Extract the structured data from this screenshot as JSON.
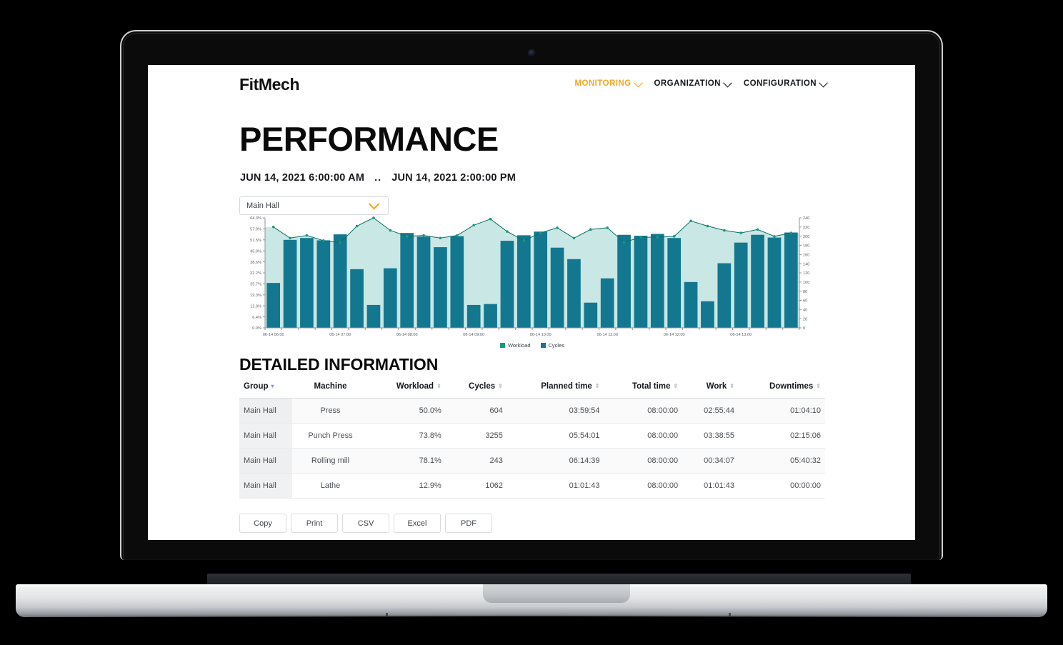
{
  "device": {
    "name": "laptop-mockup"
  },
  "nav": {
    "brand": "FitMech",
    "items": [
      {
        "label": "MONITORING",
        "active": true
      },
      {
        "label": "ORGANIZATION",
        "active": false
      },
      {
        "label": "CONFIGURATION",
        "active": false
      }
    ]
  },
  "page": {
    "title": "PERFORMANCE",
    "date_from": "JUN 14, 2021 6:00:00 AM",
    "date_sep": "..",
    "date_to": "JUN 14, 2021 2:00:00 PM",
    "group_select": {
      "value": "Main Hall"
    },
    "section_title": "DETAILED INFORMATION"
  },
  "colors": {
    "accent": "#F5A623",
    "cycles_bar": "#13788f",
    "cycles_bar_dark": "#136a84",
    "workload_line": "#17997f",
    "workload_area": "#c9e7e5",
    "text": "#14171a"
  },
  "chart_data": {
    "type": "bar",
    "title": "",
    "xlabel": "",
    "ylabel": "",
    "legend": [
      {
        "name": "Workload",
        "color": "#17997f"
      },
      {
        "name": "Cycles",
        "color": "#13788f"
      }
    ],
    "legend_position": "bottom-center",
    "grid": false,
    "y_left": {
      "label": "Workload",
      "ticks": [
        "0.0%",
        "6.4%",
        "12.9%",
        "19.3%",
        "25.7%",
        "32.2%",
        "38.6%",
        "45.0%",
        "51.5%",
        "57.9%",
        "64.3%"
      ],
      "min": 0.0,
      "max": 64.3
    },
    "y_right": {
      "label": "Cycles",
      "ticks": [
        0,
        20,
        40,
        60,
        80,
        100,
        120,
        140,
        160,
        180,
        200,
        220,
        240
      ],
      "min": 0,
      "max": 240
    },
    "x_ticks": [
      "06-14 06:00",
      "06-14 07:00",
      "06-14 08:00",
      "06-14 09:00",
      "06-14 10:00",
      "06-14 11:00",
      "06-14 12:00",
      "06-14 13:00"
    ],
    "x": [
      "06-14 06:00",
      "06-14 06:15",
      "06-14 06:30",
      "06-14 06:45",
      "06-14 07:00",
      "06-14 07:15",
      "06-14 07:30",
      "06-14 07:45",
      "06-14 08:00",
      "06-14 08:15",
      "06-14 08:30",
      "06-14 08:45",
      "06-14 09:00",
      "06-14 09:15",
      "06-14 09:30",
      "06-14 09:45",
      "06-14 10:00",
      "06-14 10:15",
      "06-14 10:30",
      "06-14 10:45",
      "06-14 11:00",
      "06-14 11:15",
      "06-14 11:30",
      "06-14 11:45",
      "06-14 12:00",
      "06-14 12:15",
      "06-14 12:30",
      "06-14 12:45",
      "06-14 13:00",
      "06-14 13:15",
      "06-14 13:30",
      "06-14 13:45"
    ],
    "series": [
      {
        "name": "Cycles",
        "type": "bar",
        "axis": "right",
        "color": "#13788f",
        "values": [
          98,
          192,
          196,
          191,
          204,
          128,
          50,
          130,
          207,
          199,
          176,
          200,
          50,
          52,
          190,
          202,
          210,
          175,
          150,
          55,
          108,
          203,
          201,
          205,
          196,
          100,
          58,
          141,
          186,
          203,
          197,
          208
        ]
      },
      {
        "name": "Workload",
        "type": "area",
        "axis": "left",
        "color": "#17997f",
        "fill": "#c9e7e5",
        "values": [
          59.0,
          52.5,
          54.0,
          51.0,
          49.8,
          59.5,
          64.3,
          57.0,
          53.5,
          54.0,
          52.5,
          54.0,
          60.0,
          63.6,
          56.3,
          51.0,
          55.5,
          58.5,
          52.5,
          57.5,
          58.5,
          50.0,
          53.0,
          53.0,
          53.5,
          62.5,
          59.5,
          57.0,
          55.5,
          57.5,
          53.5,
          55.5
        ]
      }
    ]
  },
  "table": {
    "columns": [
      {
        "label": "Group",
        "sortable": true,
        "sorted": "desc",
        "align": "left"
      },
      {
        "label": "Machine",
        "sortable": true,
        "align": "center"
      },
      {
        "label": "Workload",
        "sortable": true,
        "align": "right"
      },
      {
        "label": "Cycles",
        "sortable": true,
        "align": "right"
      },
      {
        "label": "Planned time",
        "sortable": true,
        "align": "right"
      },
      {
        "label": "Total time",
        "sortable": true,
        "align": "right"
      },
      {
        "label": "Work",
        "sortable": true,
        "align": "right"
      },
      {
        "label": "Downtimes",
        "sortable": true,
        "align": "right"
      }
    ],
    "rows": [
      {
        "group": "Main Hall",
        "machine": "Press",
        "workload": "50.0%",
        "cycles": "604",
        "planned": "03:59:54",
        "total": "08:00:00",
        "work": "02:55:44",
        "downtimes": "01:04:10"
      },
      {
        "group": "Main Hall",
        "machine": "Punch Press",
        "workload": "73.8%",
        "cycles": "3255",
        "planned": "05:54:01",
        "total": "08:00:00",
        "work": "03:38:55",
        "downtimes": "02:15:06"
      },
      {
        "group": "Main Hall",
        "machine": "Rolling mill",
        "workload": "78.1%",
        "cycles": "243",
        "planned": "06:14:39",
        "total": "08:00:00",
        "work": "00:34:07",
        "downtimes": "05:40:32"
      },
      {
        "group": "Main Hall",
        "machine": "Lathe",
        "workload": "12.9%",
        "cycles": "1062",
        "planned": "01:01:43",
        "total": "08:00:00",
        "work": "01:01:43",
        "downtimes": "00:00:00"
      }
    ]
  },
  "export_buttons": [
    {
      "label": "Copy"
    },
    {
      "label": "Print"
    },
    {
      "label": "CSV"
    },
    {
      "label": "Excel"
    },
    {
      "label": "PDF"
    }
  ]
}
